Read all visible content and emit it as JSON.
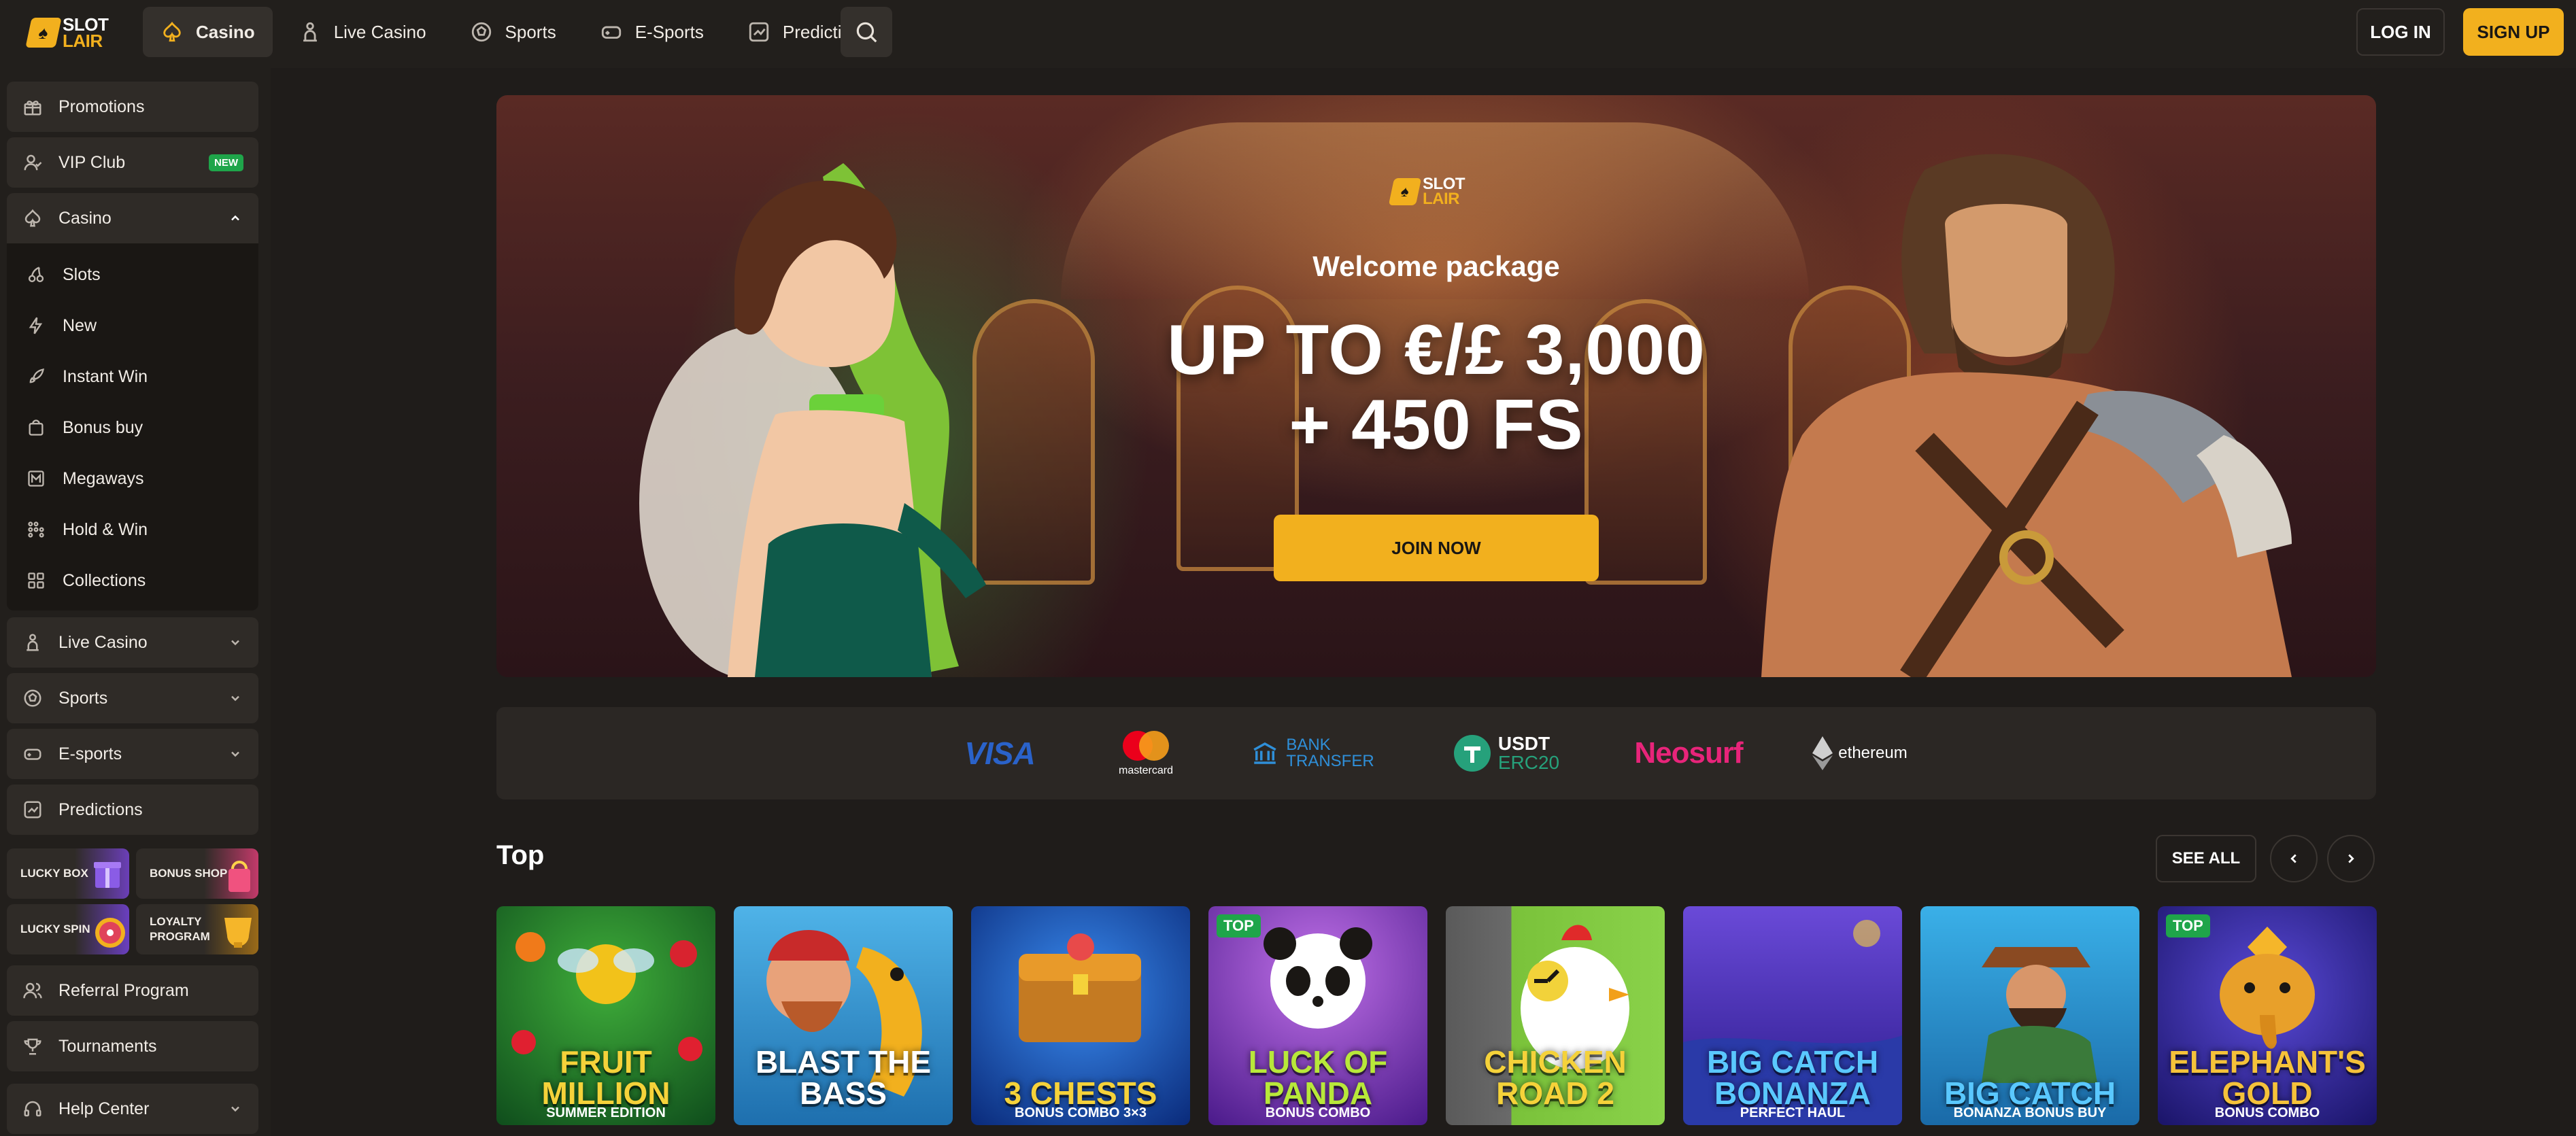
{
  "brand": {
    "line1": "SLOT",
    "line2": "LAIR",
    "accent": "#f2b01e",
    "background": "#1f1c1a"
  },
  "nav": {
    "items": [
      {
        "label": "Casino",
        "icon": "spade-icon",
        "active": true
      },
      {
        "label": "Live Casino",
        "icon": "dealer-icon",
        "active": false
      },
      {
        "label": "Sports",
        "icon": "soccer-ball-icon",
        "active": false
      },
      {
        "label": "E-Sports",
        "icon": "gamepad-icon",
        "active": false
      },
      {
        "label": "Predictions",
        "icon": "chart-icon",
        "active": false
      }
    ],
    "search_icon": "search-icon",
    "login_label": "LOG IN",
    "signup_label": "SIGN UP"
  },
  "sidebar": {
    "promotions": "Promotions",
    "vip": "VIP Club",
    "vip_badge": "NEW",
    "casino": "Casino",
    "casino_sub": [
      {
        "label": "Slots",
        "icon": "cherries-icon"
      },
      {
        "label": "New",
        "icon": "lightning-icon"
      },
      {
        "label": "Instant Win",
        "icon": "rocket-icon"
      },
      {
        "label": "Bonus buy",
        "icon": "shopping-bag-icon"
      },
      {
        "label": "Megaways",
        "icon": "megaways-icon"
      },
      {
        "label": "Hold & Win",
        "icon": "dots-grid-icon"
      },
      {
        "label": "Collections",
        "icon": "collections-icon"
      }
    ],
    "live_casino": "Live Casino",
    "sports": "Sports",
    "esports": "E-sports",
    "predictions": "Predictions",
    "tiles": {
      "lucky_box": "LUCKY BOX",
      "bonus_shop": "BONUS SHOP",
      "lucky_spin": "LUCKY SPIN",
      "loyalty_program": "LOYALTY PROGRAM"
    },
    "referral": "Referral Program",
    "tournaments": "Tournaments",
    "help": "Help Center"
  },
  "hero": {
    "title": "Welcome package",
    "headline_line1": "UP TO €/£ 3,000",
    "headline_line2": "+ 450 FS",
    "cta": "JOIN NOW"
  },
  "payments": {
    "visa": "VISA",
    "mastercard": "mastercard",
    "bank_line1": "BANK",
    "bank_line2": "TRANSFER",
    "usdt_line1": "USDT",
    "usdt_line2": "ERC20",
    "neosurf": "Neosurf",
    "ethereum": "ethereum"
  },
  "top_section": {
    "title": "Top",
    "see_all": "SEE ALL",
    "games": [
      {
        "name": "FRUIT MILLION",
        "sub": "SUMMER EDITION",
        "badge": ""
      },
      {
        "name": "BLAST THE BASS",
        "sub": "",
        "badge": ""
      },
      {
        "name": "3 CHESTS",
        "sub": "BONUS COMBO 3×3",
        "badge": ""
      },
      {
        "name": "LUCK OF PANDA",
        "sub": "BONUS COMBO",
        "badge": "TOP"
      },
      {
        "name": "CHICKEN ROAD 2",
        "sub": "",
        "badge": ""
      },
      {
        "name": "BIG CATCH BONANZA",
        "sub": "PERFECT HAUL",
        "badge": ""
      },
      {
        "name": "BIG CATCH",
        "sub": "BONANZA BONUS BUY",
        "badge": ""
      },
      {
        "name": "ELEPHANT'S GOLD",
        "sub": "BONUS COMBO",
        "badge": "TOP"
      }
    ]
  }
}
